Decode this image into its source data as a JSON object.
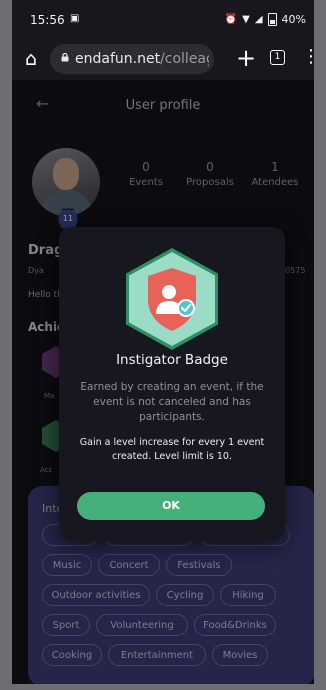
{
  "statusbar": {
    "time": "15:56",
    "battery": "40%"
  },
  "browser": {
    "url_domain": "endafun.net",
    "url_path": "/colleag",
    "tab_count": "1"
  },
  "page": {
    "title": "User profile",
    "stats": [
      {
        "value": "0",
        "label": "Events"
      },
      {
        "value": "0",
        "label": "Proposals"
      },
      {
        "value": "1",
        "label": "Atendees"
      }
    ],
    "level": "11",
    "user_name_partial": "Drago",
    "user_meta_partial": "Dya",
    "user_code_partial": "30575",
    "bio_partial": "Hello th",
    "achievements_title_partial": "Achie",
    "achievement_labels": [
      "Ma",
      "Acc"
    ],
    "interests_title_partial": "Inte",
    "interests_rows": [
      [
        "Music",
        "Concert",
        "Festivals"
      ],
      [
        "Outdoor activities",
        "Cycling",
        "Hiking"
      ],
      [
        "Sport",
        "Volunteering",
        "Food&Drinks"
      ],
      [
        "Cooking",
        "Entertainment",
        "Movies"
      ]
    ]
  },
  "modal": {
    "title": "Instigator Badge",
    "description": "Earned by creating an event, if the event is not canceled and has participants.",
    "rule": "Gain a level increase for every 1 event created. Level limit is 10.",
    "ok_label": "OK"
  },
  "colors": {
    "accent_green": "#46b07b",
    "badge_shield_red": "#e8625a",
    "interests_bg": "#3b3d75"
  }
}
